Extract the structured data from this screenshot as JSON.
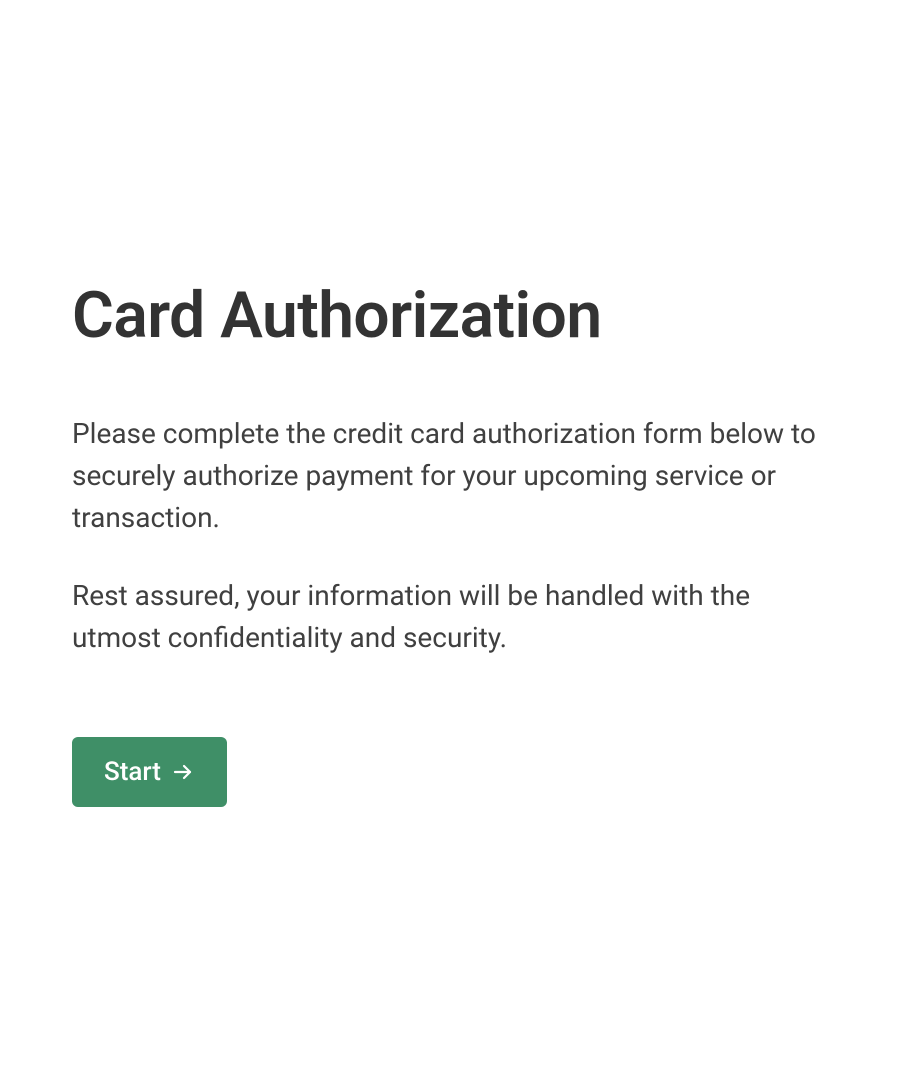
{
  "page": {
    "title": "Card Authorization",
    "paragraph1": "Please complete the credit card authorization form below to securely authorize payment for your upcoming service or transaction.",
    "paragraph2": "Rest assured, your information will be handled with the utmost confidentiality and security."
  },
  "button": {
    "start_label": "Start"
  },
  "colors": {
    "accent": "#3f8f67",
    "text_primary": "#333333",
    "text_body": "#404040"
  }
}
